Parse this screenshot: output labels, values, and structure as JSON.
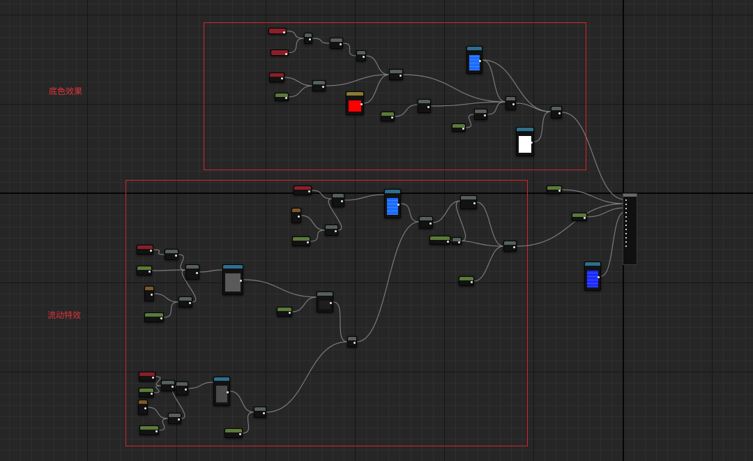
{
  "editor": {
    "comments": [
      {
        "id": "base-color",
        "label": "底色效果"
      },
      {
        "id": "flow-effect",
        "label": "流动特效"
      }
    ]
  },
  "colors": {
    "background": "#262626",
    "comment_border": "#d8242c",
    "comment_text": "#e0343c",
    "texture_blue": "#1a6cff",
    "texture_dark_blue": "#1a2cff",
    "vector_red": "#ff0000",
    "vector_white": "#ffffff",
    "wire": "#8a8a8a",
    "parameter_header_red": "#8a1f27",
    "scalar_header_green": "#5b7a3a"
  },
  "icons": [
    "output-pin-icon",
    "input-pin-icon",
    "texture-preview-icon",
    "color-swatch-icon"
  ]
}
